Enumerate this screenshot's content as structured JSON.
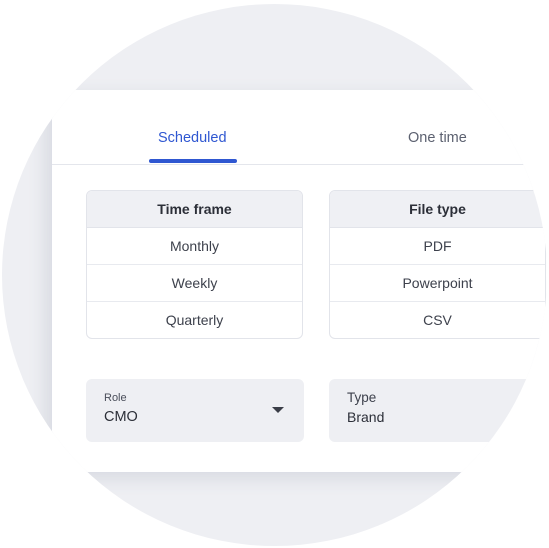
{
  "tabs": [
    {
      "label": "Scheduled",
      "active": true
    },
    {
      "label": "One time",
      "active": false
    }
  ],
  "timeframe": {
    "header": "Time frame",
    "rows": [
      "Monthly",
      "Weekly",
      "Quarterly"
    ]
  },
  "filetype": {
    "header": "File type",
    "rows": [
      "PDF",
      "Powerpoint",
      "CSV"
    ]
  },
  "role_select": {
    "label": "Role",
    "value": "CMO"
  },
  "type_select": {
    "label": "Type",
    "value": "Brand"
  },
  "colors": {
    "accent": "#2f57d1",
    "background_circle": "#eeeff3",
    "card": "#ffffff"
  },
  "icons": {
    "dropdown": "chevron-down-icon"
  }
}
